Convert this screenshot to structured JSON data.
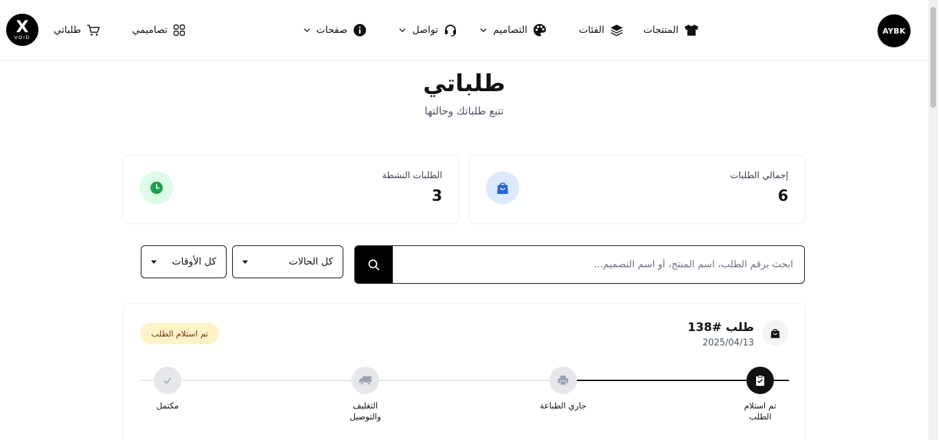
{
  "header": {
    "logo_right": "AYBK",
    "logo_left_mark": "X",
    "logo_left_text": "VOID",
    "nav": {
      "products": "المنتجات",
      "categories": "الفئات",
      "designs": "التصاميم",
      "contact": "تواصل",
      "pages": "صفحات"
    },
    "my_designs": "تصاميمي",
    "my_orders": "طلباتي"
  },
  "page": {
    "title": "طلباتي",
    "subtitle": "تتبع طلباتك وحالتها"
  },
  "stats": {
    "total_label": "إجمالي الطلبات",
    "total_value": "6",
    "active_label": "الطلبات النشطة",
    "active_value": "3"
  },
  "filters": {
    "search_placeholder": "ابحث برقم الطلب، اسم المنتج، أو اسم التصميم...",
    "status_value": "كل الحالات",
    "time_value": "كل الأوقات"
  },
  "order": {
    "title": "طلب #138",
    "date": "2025/04/13",
    "status": "تم استلام الطلب",
    "progress_completed_steps": 1,
    "steps": [
      {
        "line1": "تم استلام",
        "line2": "الطلب"
      },
      {
        "line1": "جاري الطباعة",
        "line2": ""
      },
      {
        "line1": "التغليف",
        "line2": "والتوصيل"
      },
      {
        "line1": "مكتمل",
        "line2": ""
      }
    ]
  },
  "colors": {
    "accent": "#000000",
    "badge_bg": "#fef3c7",
    "badge_text": "#78350f",
    "blue_icon_bg": "#dbeafe",
    "blue_icon": "#2563eb",
    "green_icon_bg": "#dcfce7",
    "green_icon": "#16a34a"
  }
}
